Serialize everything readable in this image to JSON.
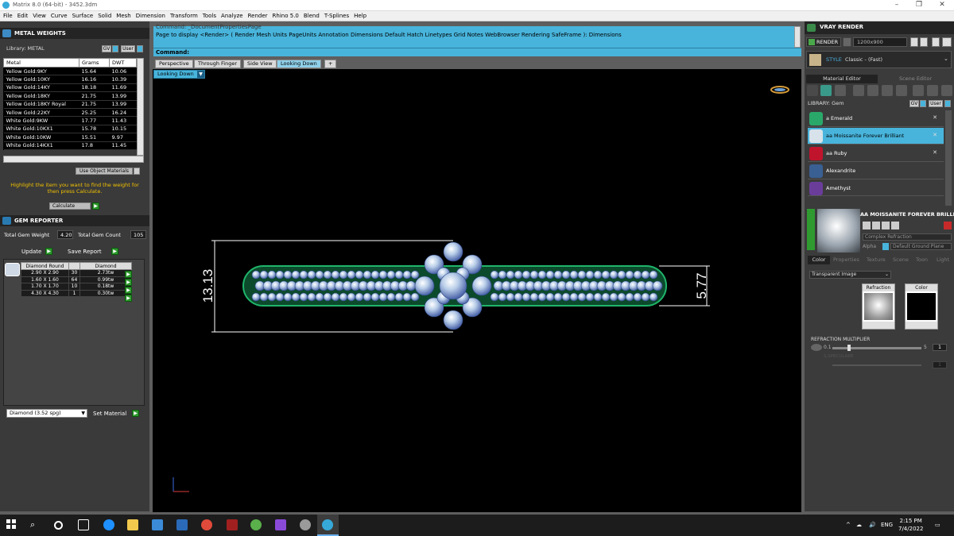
{
  "window": {
    "title": "Matrix 8.0 (64-bit) - 3452.3dm",
    "controls": {
      "minimize": "–",
      "maximize": "❐",
      "close": "✕"
    }
  },
  "menu": [
    "File",
    "Edit",
    "View",
    "Curve",
    "Surface",
    "Solid",
    "Mesh",
    "Dimension",
    "Transform",
    "Tools",
    "Analyze",
    "Render",
    "Rhino 5.0",
    "Blend",
    "T-Splines",
    "Help"
  ],
  "metal_weights": {
    "header": "METAL WEIGHTS",
    "library_label": "Library: METAL",
    "lib_btn_gv": "GV",
    "lib_btn_user": "User",
    "columns": [
      "Metal",
      "Grams",
      "DWT"
    ],
    "rows": [
      [
        "Yellow Gold:9KY",
        "15.64",
        "10.06"
      ],
      [
        "Yellow Gold:10KY",
        "16.16",
        "10.39"
      ],
      [
        "Yellow Gold:14KY",
        "18.18",
        "11.69"
      ],
      [
        "Yellow Gold:18KY",
        "21.75",
        "13.99"
      ],
      [
        "Yellow Gold:18KY Royal",
        "21.75",
        "13.99"
      ],
      [
        "Yellow Gold:22KY",
        "25.25",
        "16.24"
      ],
      [
        "White Gold:9KW",
        "17.77",
        "11.43"
      ],
      [
        "White Gold:10KX1",
        "15.78",
        "10.15"
      ],
      [
        "White Gold:10KW",
        "15.51",
        "9.97"
      ],
      [
        "White Gold:14KX1",
        "17.8",
        "11.45"
      ]
    ],
    "use_object_materials": "Use Object Materials",
    "hint": "Highlight the item you want to find the weight for then press Calculate.",
    "calculate": "Calculate"
  },
  "gem_reporter": {
    "header": "GEM REPORTER",
    "total_weight_label": "Total Gem Weight",
    "total_weight_value": "4.20",
    "total_count_label": "Total Gem Count",
    "total_count_value": "105",
    "update": "Update",
    "save_report": "Save Report",
    "columns": [
      "Diamond Round",
      "",
      "Diamond"
    ],
    "rows": [
      [
        "2.90 X 2.90",
        "30",
        "2.73tw"
      ],
      [
        "1.60 X 1.60",
        "64",
        "0.99tw"
      ],
      [
        "1.70 X 1.70",
        "10",
        "0.18tw"
      ],
      [
        "4.30 X 4.30",
        "1",
        "0.30tw"
      ]
    ],
    "material_select": "Diamond   (3.52 spg)",
    "set_material": "Set Material"
  },
  "command": {
    "line1": "Command: _DocumentPropertiesPage",
    "line2": "Page to display <Render> ( Render  Mesh  Units  PageUnits  Annotation  Dimensions  Default  Hatch  Linetypes  Grid  Notes  WebBrowser  Rendering  SafeFrame ): Dimensions",
    "prompt": "Command:"
  },
  "viewport_tabs": [
    "Perspective",
    "Through Finger",
    "Side View",
    "Looking Down",
    "+"
  ],
  "viewport_dropdown": "Looking Down",
  "dimensions": {
    "left": "13.13",
    "right": "5.77"
  },
  "vray": {
    "header": "VRAY RENDER",
    "render_btn": "RENDER",
    "resolution": "1200x900",
    "style_label": "STYLE",
    "style_value": "Classic - (Fast)",
    "tabs": [
      "Material Editor",
      "Scene Editor"
    ],
    "library_label": "LIBRARY: Gem",
    "lib_btn_gv": "GV",
    "lib_btn_user": "User",
    "materials": [
      {
        "name": "a Emerald",
        "color": "#2aa86a"
      },
      {
        "name": "aa Moissanite Forever Brilliant",
        "color": "#d8e2ea"
      },
      {
        "name": "aa Ruby",
        "color": "#c0142c"
      },
      {
        "name": "Alexandrite",
        "color": "#3a5f92"
      },
      {
        "name": "Amethyst",
        "color": "#6a3d9a"
      }
    ],
    "selected_material_title": "AA MOISSANITE FOREVER BRILLIANT",
    "complex_refraction": "Complex Refraction",
    "alpha_label": "Alpha",
    "default_ground_plane": "Default Ground Plane",
    "prop_tabs": [
      "Color",
      "Properties",
      "Texture",
      "Scene",
      "Toon",
      "Light"
    ],
    "transparent_image": "Transparent Image",
    "refraction_label": "Refraction",
    "color_label": "Color",
    "refraction_multiplier": "REFRACTION MULTIPLIER",
    "slider_min": "0.1",
    "slider_max": "5",
    "slider_value": "1",
    "slider2_label": "S.SPECULARE",
    "slider2_value": "1"
  },
  "taskbar": {
    "time": "2:15 PM",
    "date": "7/4/2022",
    "lang": "ENG"
  }
}
